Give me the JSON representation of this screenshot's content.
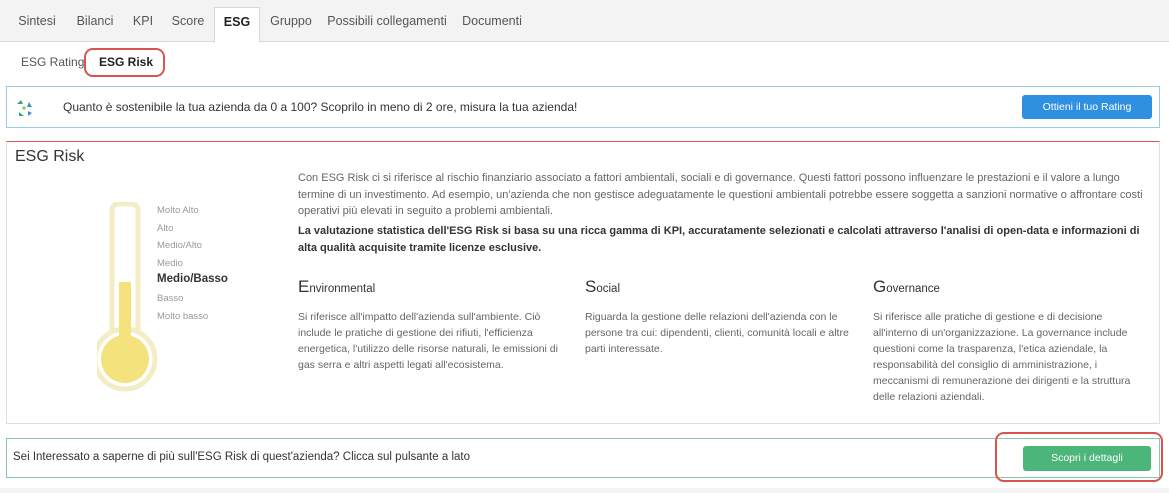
{
  "tabs": [
    {
      "label": "Sintesi"
    },
    {
      "label": "Bilanci"
    },
    {
      "label": "KPI"
    },
    {
      "label": "Score"
    },
    {
      "label": "ESG",
      "active": true
    },
    {
      "label": "Gruppo"
    },
    {
      "label": "Possibili collegamenti"
    },
    {
      "label": "Documenti"
    }
  ],
  "subtabs": [
    {
      "label": "ESG Rating"
    },
    {
      "label": "ESG Risk",
      "active": true
    }
  ],
  "promo": {
    "text": "Quanto è sostenibile la tua azienda da 0 a 100? Scoprilo in meno di 2 ore, misura la tua azienda!",
    "button_label": "Ottieni il tuo Rating",
    "icon": "recycle-icon"
  },
  "risk": {
    "title": "ESG Risk",
    "levels": [
      "Molto Alto",
      "Alto",
      "Medio/Alto",
      "Medio",
      "Medio/Basso",
      "Basso",
      "Molto basso"
    ],
    "current_level": "Medio/Basso",
    "intro": "Con ESG Risk ci si riferisce al rischio finanziario associato a fattori ambientali, sociali e di governance. Questi fattori possono influenzare le prestazioni e il valore a lungo termine di un investimento. Ad esempio, un'azienda che non gestisce adeguatamente le questioni ambientali potrebbe essere soggetta a sanzioni normative o affrontare costi operativi più elevati in seguito a problemi ambientali.",
    "intro_bold": "La valutazione statistica dell'ESG Risk si basa su una ricca gamma di KPI, accuratamente selezionati e calcolati attraverso l'analisi di open-data e informazioni di alta qualità acquisite tramite licenze esclusive.",
    "columns": [
      {
        "initial": "E",
        "rest": "nvironmental",
        "text": "Si riferisce all'impatto dell'azienda sull'ambiente. Ciò include le pratiche di gestione dei rifiuti, l'efficienza energetica, l'utilizzo delle risorse naturali, le emissioni di gas serra e altri aspetti legati all'ecosistema."
      },
      {
        "initial": "S",
        "rest": "ocial",
        "text": "Riguarda la gestione delle relazioni dell'azienda con le persone tra cui: dipendenti, clienti, comunità locali e altre parti interessate."
      },
      {
        "initial": "G",
        "rest": "overnance",
        "text": "Si riferisce alle pratiche di gestione e di decisione all'interno di un'organizzazione. La governance include questioni come la trasparenza, l'etica aziendale, la responsabilità del consiglio di amministrazione, i meccanismi di remunerazione dei dirigenti e la struttura delle relazioni aziendali."
      }
    ]
  },
  "cta": {
    "text": "Sei Interessato a saperne di più sull'ESG Risk di quest'azienda? Clicca sul pulsante a lato",
    "button_label": "Scopri i dettagli"
  },
  "colors": {
    "accent_blue": "#2f8fe0",
    "accent_green": "#4cb57a",
    "highlight_red": "#d9534f",
    "thermo_fill": "#f4e27d"
  }
}
